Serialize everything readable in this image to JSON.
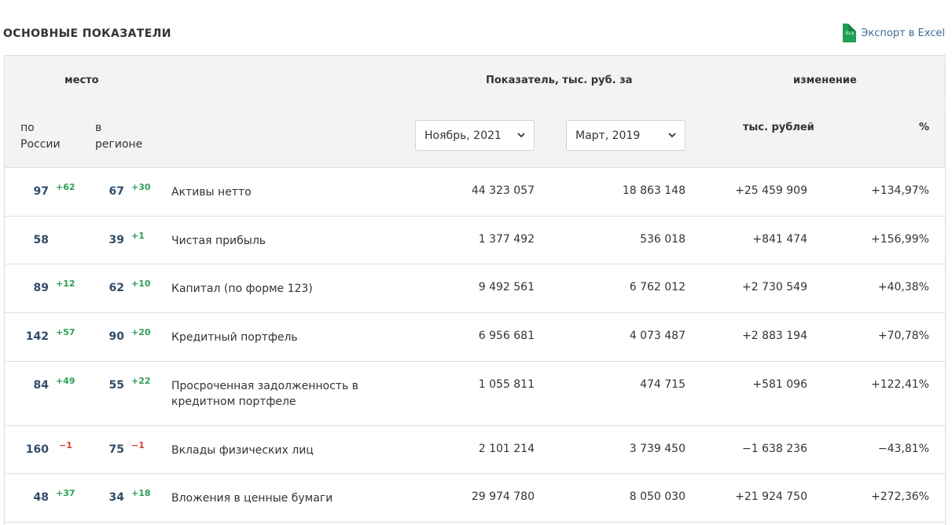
{
  "header": {
    "title": "ОСНОВНЫЕ ПОКАЗАТЕЛИ",
    "export_label": "Экспорт в Excel",
    "xls_badge": "XLS"
  },
  "table_head": {
    "place": "место",
    "indicator": "Показатель, тыс. руб. за",
    "change": "изменение",
    "by_russia": "по России",
    "in_region": "в регионе",
    "select_current": "Ноябрь, 2021",
    "select_compare": "Март, 2019",
    "change_abs": "тыс. рублей",
    "change_pct": "%"
  },
  "colors": {
    "positive": "#2e9e55",
    "negative": "#d83b2b",
    "rank": "#2f4d6b",
    "header_bg": "#f2f3f5"
  },
  "rows": [
    {
      "rank_ru": "97",
      "delta_ru": "+62",
      "rank_reg": "67",
      "delta_reg": "+30",
      "name": "Активы нетто",
      "v1": "44 323 057",
      "v2": "18 863 148",
      "chg": "+25 459 909",
      "pct": "+134,97%",
      "trend": "pos"
    },
    {
      "rank_ru": "58",
      "delta_ru": "",
      "rank_reg": "39",
      "delta_reg": "+1",
      "name": "Чистая прибыль",
      "v1": "1 377 492",
      "v2": "536 018",
      "chg": "+841 474",
      "pct": "+156,99%",
      "trend": "pos"
    },
    {
      "rank_ru": "89",
      "delta_ru": "+12",
      "rank_reg": "62",
      "delta_reg": "+10",
      "name": "Капитал (по форме 123)",
      "v1": "9 492 561",
      "v2": "6 762 012",
      "chg": "+2 730 549",
      "pct": "+40,38%",
      "trend": "pos"
    },
    {
      "rank_ru": "142",
      "delta_ru": "+57",
      "rank_reg": "90",
      "delta_reg": "+20",
      "name": "Кредитный портфель",
      "v1": "6 956 681",
      "v2": "4 073 487",
      "chg": "+2 883 194",
      "pct": "+70,78%",
      "trend": "pos"
    },
    {
      "rank_ru": "84",
      "delta_ru": "+49",
      "rank_reg": "55",
      "delta_reg": "+22",
      "name": "Просроченная задолженность в кредитном портфеле",
      "v1": "1 055 811",
      "v2": "474 715",
      "chg": "+581 096",
      "pct": "+122,41%",
      "trend": "pos"
    },
    {
      "rank_ru": "160",
      "delta_ru": "−1",
      "rank_reg": "75",
      "delta_reg": "−1",
      "name": "Вклады физических лиц",
      "v1": "2 101 214",
      "v2": "3 739 450",
      "chg": "−1 638 236",
      "pct": "−43,81%",
      "trend": "neg"
    },
    {
      "rank_ru": "48",
      "delta_ru": "+37",
      "rank_reg": "34",
      "delta_reg": "+18",
      "name": "Вложения в ценные бумаги",
      "v1": "29 974 780",
      "v2": "8 050 030",
      "chg": "+21 924 750",
      "pct": "+272,36%",
      "trend": "pos"
    }
  ]
}
